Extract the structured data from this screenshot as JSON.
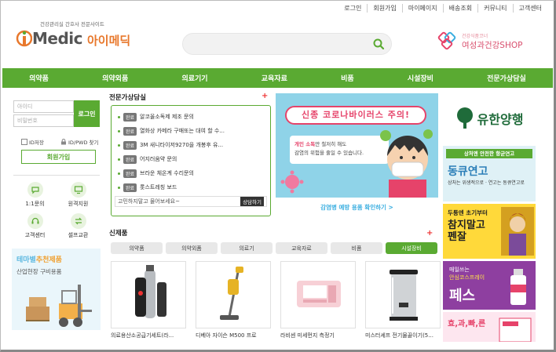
{
  "top_links": [
    "로그인",
    "회원가입",
    "마이페이지",
    "배송조회",
    "커뮤니티",
    "고객센터"
  ],
  "logo": {
    "tagline": "건강관리실 간호사 전문사이트",
    "brand_en": "Medic",
    "brand_kr": "아이메딕"
  },
  "search": {
    "placeholder": ""
  },
  "shop": {
    "sub": "건강식품코너",
    "main": "여성과건강SHOP"
  },
  "main_nav": [
    "의약품",
    "의약외품",
    "의료기기",
    "교육자료",
    "비품",
    "시설장비",
    "전문가상담실"
  ],
  "login": {
    "id_placeholder": "아이디",
    "pw_placeholder": "비밀번호",
    "login_button": "로그인",
    "save_id": "ID저장",
    "find": "ID/PWD 찾기",
    "join": "회원가입"
  },
  "quick_links": [
    {
      "label": "1:1문의",
      "icon": "chat-icon"
    },
    {
      "label": "원격지원",
      "icon": "monitor-icon"
    },
    {
      "label": "고객센터",
      "icon": "headset-icon"
    },
    {
      "label": "셀프교환",
      "icon": "exchange-icon"
    }
  ],
  "left_banner": {
    "title_a": "테마별",
    "title_b": "추천제품",
    "sub": "산업현장 구비용품"
  },
  "advice": {
    "title": "전문가상담실",
    "items": [
      {
        "badge": "완료",
        "text": "알코올소독제 제조 문의"
      },
      {
        "badge": "완료",
        "text": "열화상 카메라 구매또는 대여 할 수..."
      },
      {
        "badge": "완료",
        "text": "3M 새니타이저9270을 개봉후 유..."
      },
      {
        "badge": "완료",
        "text": "어지러움약 문의"
      },
      {
        "badge": "완료",
        "text": "브라운 체온계 수리문의"
      },
      {
        "badge": "완료",
        "text": "롯스트레칭 보드"
      }
    ],
    "ask_text": "고민하지말고 물어보세요~",
    "ask_button": "상담하기"
  },
  "flu_banner": {
    "title": "신종 코로나바이러스 주의!",
    "line1_a": "개인 소독",
    "line1_b": "만 철저히 해도",
    "line2": "감염의 위험을 줄일 수 있습니다.",
    "cta": "감염병 예방 용품 확인하기 >"
  },
  "new_products": {
    "title": "신제품",
    "categories": [
      "의약품",
      "의약외품",
      "의료기",
      "교육자료",
      "비품",
      "시설장비"
    ],
    "active_category": "시설장비",
    "items": [
      {
        "name": "의료용산소공급기세트(라..."
      },
      {
        "name": "디베아 자이슨 M500 프로"
      },
      {
        "name": "라비센 미세먼지 측정기"
      },
      {
        "name": "미스터셰프 전기물끓이기(5..."
      }
    ]
  },
  "right_ads": {
    "yuhan": "유한양행",
    "dong_top": "상처엔 안전한 항균연고",
    "dong_main": "동큐연고",
    "dong_sub": "상처는 위생적으로 · 연고는 동큐연고로",
    "chamji_top": "두통엔 초기부터",
    "chamji_main": "참지말고 펜잘",
    "pess_top": "매일쓰는",
    "pess_sub": "안심코스프레이",
    "pess_main": "페스",
    "bottom": "효,과,빠,른"
  }
}
